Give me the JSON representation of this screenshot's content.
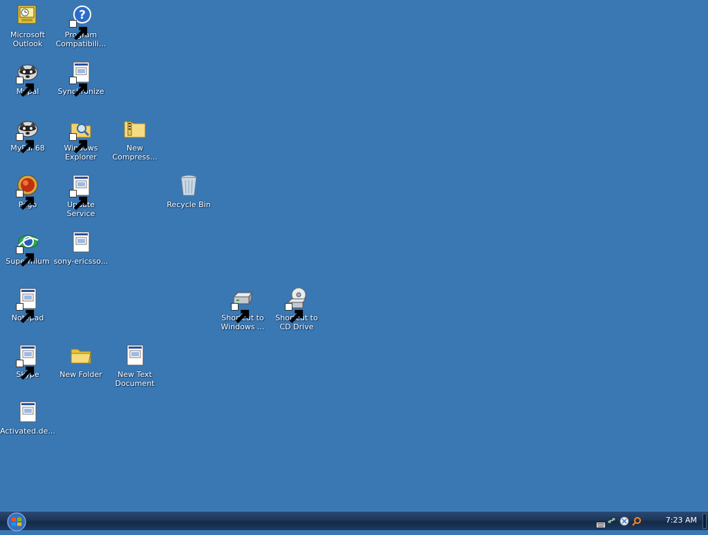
{
  "desktop": {
    "icons": [
      {
        "id": "outlook",
        "label": "Microsoft Outlook",
        "icon": "outlook-icon",
        "shortcut": false
      },
      {
        "id": "progcompat",
        "label": "Program Compatibili...",
        "icon": "help-icon",
        "shortcut": true
      },
      {
        "id": "mypal",
        "label": "Mypal",
        "icon": "raccoon-icon",
        "shortcut": true
      },
      {
        "id": "synchronize",
        "label": "Synchronize",
        "icon": "executable-icon",
        "shortcut": true
      },
      {
        "id": "mypal68",
        "label": "MyPal 68",
        "icon": "raccoon-icon",
        "shortcut": true
      },
      {
        "id": "winexplorer",
        "label": "Windows Explorer",
        "icon": "explorer-folder-icon",
        "shortcut": true
      },
      {
        "id": "newcompressed",
        "label": "New Compress...",
        "icon": "zip-folder-icon",
        "shortcut": false
      },
      {
        "id": "pego",
        "label": "Pego",
        "icon": "pego-icon",
        "shortcut": true
      },
      {
        "id": "updateservice",
        "label": "Update Service",
        "icon": "executable-icon",
        "shortcut": true
      },
      {
        "id": "recyclebin",
        "label": "Recycle Bin",
        "icon": "recycle-bin-icon",
        "shortcut": false
      },
      {
        "id": "supermium",
        "label": "Supermium",
        "icon": "supermium-icon",
        "shortcut": true
      },
      {
        "id": "sonyericsson",
        "label": "sony-ericsso...",
        "icon": "executable-icon",
        "shortcut": false
      },
      {
        "id": "notepad",
        "label": "Notepad",
        "icon": "executable-icon",
        "shortcut": true
      },
      {
        "id": "shortcutwindows",
        "label": "Shortcut to Windows ...",
        "icon": "hard-drive-icon",
        "shortcut": true
      },
      {
        "id": "shortcutcd",
        "label": "Shortcut to CD Drive",
        "icon": "cd-drive-icon",
        "shortcut": true
      },
      {
        "id": "skype",
        "label": "Skype",
        "icon": "executable-icon",
        "shortcut": true
      },
      {
        "id": "newfolder",
        "label": "New Folder",
        "icon": "folder-icon",
        "shortcut": false
      },
      {
        "id": "newtextdoc",
        "label": "New Text Document",
        "icon": "executable-icon",
        "shortcut": false
      },
      {
        "id": "activated",
        "label": "Activated.de...",
        "icon": "executable-icon",
        "shortcut": false
      }
    ]
  },
  "taskbar": {
    "clock": "7:23 AM",
    "tray_icons": [
      "keyboard-icon",
      "network-icon",
      "skype-tray-icon",
      "search-tray-icon"
    ]
  },
  "colors": {
    "desktop_background": "#3a78b4",
    "taskbar": "#1d3658"
  }
}
